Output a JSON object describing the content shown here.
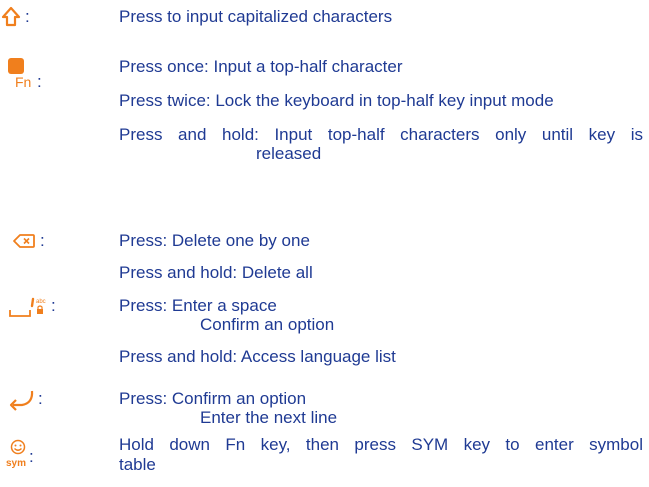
{
  "colors": {
    "text": "#1f3a93",
    "icon": "#f07f1d"
  },
  "rows": {
    "shift": {
      "icon": "shift-arrow-icon",
      "colon": ":",
      "lines": [
        "Press to input capitalized characters"
      ]
    },
    "fn": {
      "icon": "fn-key-icon",
      "label": "Fn",
      "colon": ":",
      "lines": [
        "Press once: Input a top-half character",
        "Press twice: Lock the keyboard in top-half key input mode",
        "Press and hold: Input top-half characters only until key is",
        "released"
      ]
    },
    "delete": {
      "icon": "backspace-icon",
      "colon": ":",
      "lines": [
        "Press: Delete one by one",
        "Press and hold: Delete all"
      ]
    },
    "space": {
      "icon": "space-key-icon",
      "icon_text": "abc",
      "colon": ":",
      "lines": [
        "Press: Enter a space",
        "Confirm an option",
        "Press and hold: Access language list"
      ]
    },
    "enter": {
      "icon": "enter-arrow-icon",
      "colon": ":",
      "lines": [
        "Press: Confirm an option",
        "Enter the next line"
      ]
    },
    "sym": {
      "icon": "smiley-sym-icon",
      "label": "sym",
      "colon": ":",
      "lines": [
        "Hold down Fn key, then press SYM key to enter symbol",
        "table"
      ]
    }
  }
}
